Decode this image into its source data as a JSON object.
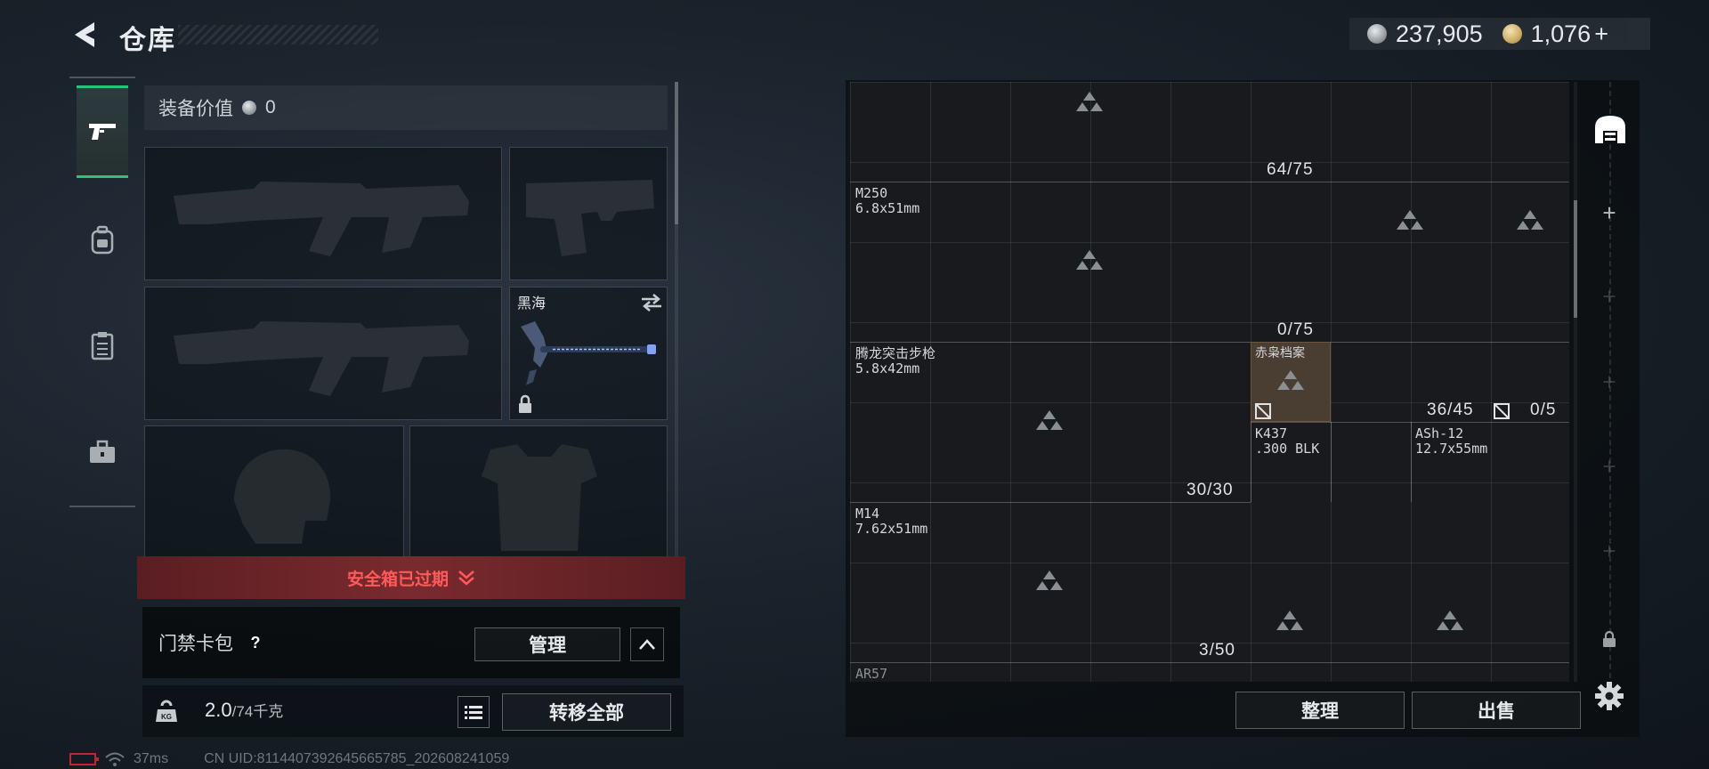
{
  "header": {
    "title": "仓库",
    "currency": [
      {
        "name": "silver",
        "value": "237,905"
      },
      {
        "name": "gold",
        "value": "1,076"
      }
    ],
    "plus_label": "+"
  },
  "left_tabs": [
    "gun-icon",
    "backpack-icon",
    "clipboard-icon",
    "toolbox-icon"
  ],
  "equipment": {
    "value_label": "装备价值",
    "value": "0",
    "melee_label": "黑海"
  },
  "safe_box": {
    "expired_label": "安全箱已过期"
  },
  "keycard": {
    "label": "门禁卡包",
    "help": "?",
    "manage_label": "管理"
  },
  "weight": {
    "current": "2.0",
    "max": "/74千克",
    "transfer_all_label": "转移全部"
  },
  "status": {
    "ping": "37ms",
    "uid": "CN UID:8114407392645665785_202608241059"
  },
  "grid": {
    "items": [
      {
        "name": "M250",
        "ammo": "6.8x51mm",
        "count": "64/75"
      },
      {
        "name": "腾龙突击步枪",
        "ammo": "5.8x42mm",
        "count": "0/75"
      },
      {
        "name": "赤枭档案",
        "ammo": "",
        "count": ""
      },
      {
        "name": "K437",
        "ammo": ".300 BLK",
        "count": "36/45"
      },
      {
        "name": "ASh-12",
        "ammo": "12.7x55mm",
        "count": "0/5"
      },
      {
        "name": "M14",
        "ammo": "7.62x51mm",
        "count": "30/30"
      },
      {
        "name": "AR57",
        "ammo": "",
        "count": "3/50"
      }
    ],
    "sort_label": "整理",
    "sell_label": "出售"
  },
  "colors": {
    "accent_green": "#29c47a",
    "alert_red": "#ff5a5a",
    "highlight_cell": "#4a3d31"
  }
}
